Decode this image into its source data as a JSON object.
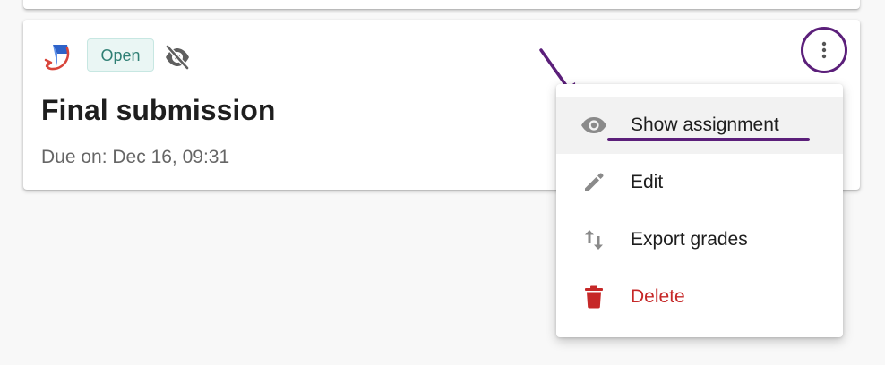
{
  "card": {
    "status_badge": "Open",
    "title": "Final submission",
    "due": "Due on: Dec 16, 09:31",
    "logo_icon": "assignment-tool-logo",
    "visibility_icon": "eye-off-icon",
    "more_icon": "more-vertical-icon"
  },
  "menu": {
    "items": [
      {
        "label": "Show assignment",
        "icon": "eye-icon",
        "highlighted": true
      },
      {
        "label": "Edit",
        "icon": "pencil-icon"
      },
      {
        "label": "Export grades",
        "icon": "sort-arrows-icon"
      },
      {
        "label": "Delete",
        "icon": "trash-icon",
        "danger": true
      }
    ]
  },
  "colors": {
    "badge_bg": "#eaf6f4",
    "badge_text": "#2f7f74",
    "annotation": "#5b1f7a",
    "danger": "#c62828"
  }
}
